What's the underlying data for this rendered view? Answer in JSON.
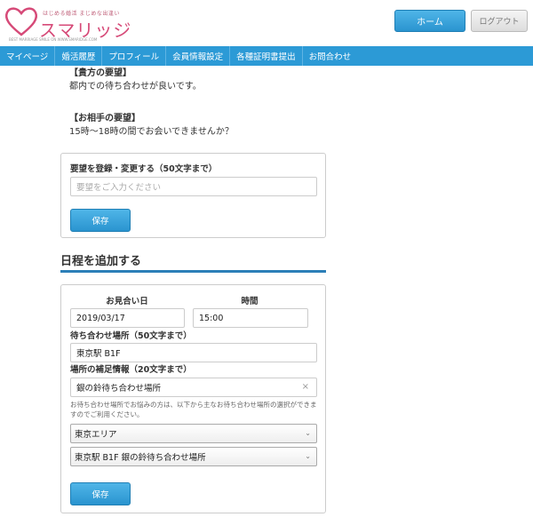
{
  "header": {
    "logo_tagline": "はじめる婚活 まじめな出逢い",
    "logo_name": "スマリッジ",
    "logo_sub": "BEST MARRIAGE SMILE ON WWW.SMARIDGE.COM",
    "home_label": "ホーム",
    "logout_label": "ログアウト"
  },
  "nav": {
    "items": [
      "マイページ",
      "婚活履歴",
      "プロフィール",
      "会員情報設定",
      "各種証明書提出",
      "お問合わせ"
    ]
  },
  "requests": {
    "own_heading": "【貴方の要望】",
    "own_text": "都内での待ち合わせが良いです。",
    "partner_heading": "【お相手の要望】",
    "partner_text": "15時〜18時の間でお会いできませんか？"
  },
  "request_form": {
    "label": "要望を登録・変更する（50文字まで）",
    "placeholder": "要望をご入力ください",
    "save_label": "保存"
  },
  "schedule": {
    "title": "日程を追加する",
    "date_header": "お見合い日",
    "time_header": "時間",
    "date_value": "2019/03/17",
    "time_value": "15:00",
    "place_label": "待ち合わせ場所（50文字まで）",
    "place_value": "東京駅 B1F",
    "detail_label": "場所の補足情報（20文字まで）",
    "detail_value": "銀の鈴待ち合わせ場所",
    "clear_glyph": "×",
    "note": "お待ち合わせ場所でお悩みの方は、以下から主なお待ち合わせ場所の選択ができますのでご利用ください。",
    "area_select": "東京エリア",
    "spot_select": "東京駅 B1F 銀の鈴待ち合わせ場所",
    "save_label": "保存"
  },
  "colors": {
    "nav": "#2c9ad6",
    "button": "#2a94cf",
    "brand": "#d64a78",
    "section_line": "#2c7fb8"
  },
  "icons": {
    "logo": "heart-icon",
    "select_arrow": "chevron-down-icon",
    "clear": "close-icon"
  }
}
